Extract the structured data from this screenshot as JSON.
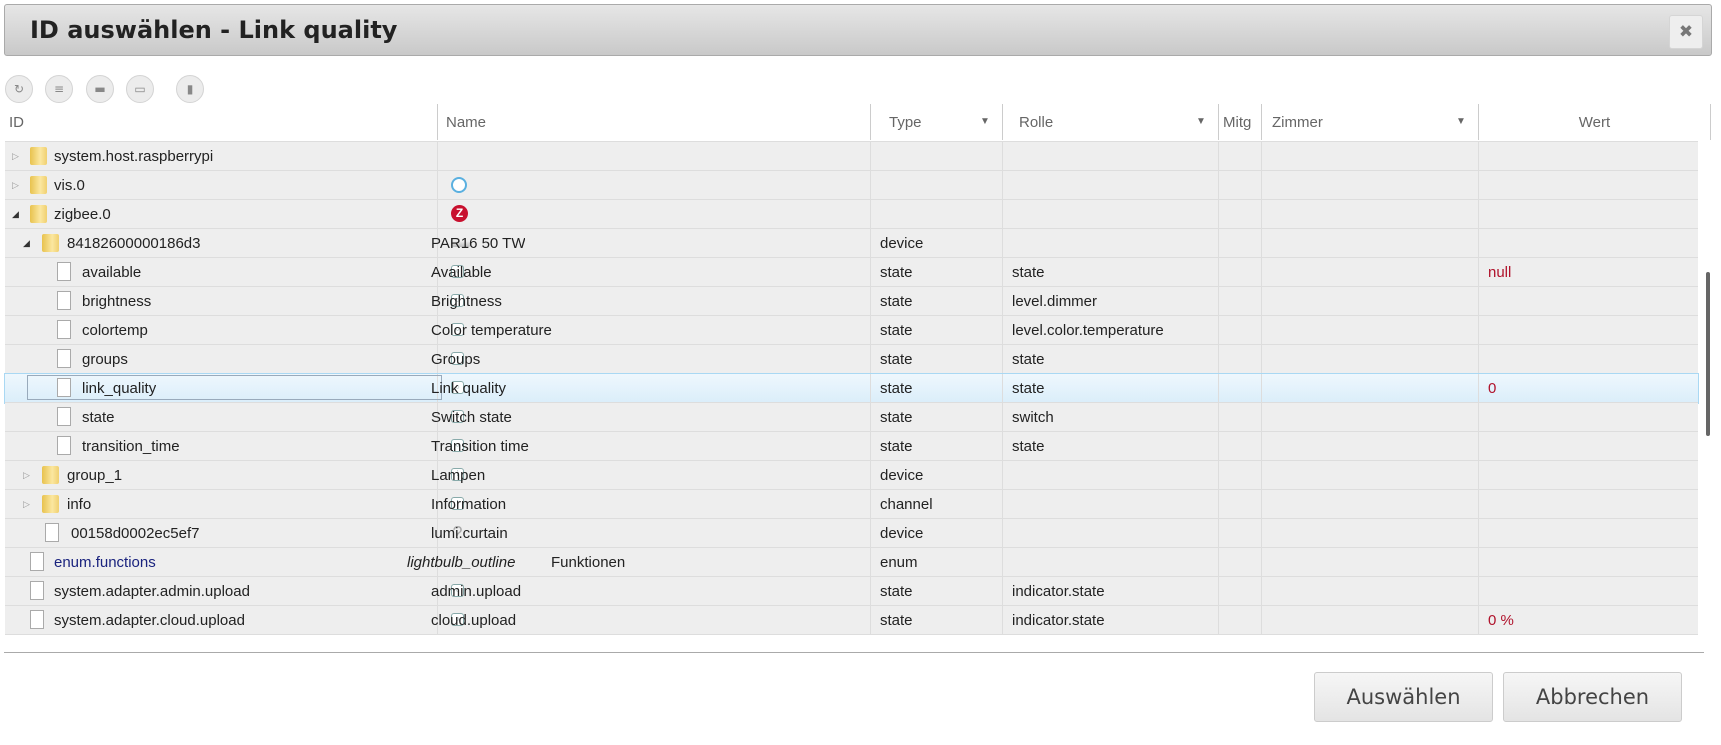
{
  "dialog": {
    "title": "ID auswählen - Link quality",
    "close_icon": "close-icon"
  },
  "toolbar": [
    {
      "icon": "refresh-icon",
      "glyph": "↻"
    },
    {
      "icon": "list-icon",
      "glyph": "≡"
    },
    {
      "icon": "folder-closed-icon",
      "glyph": "▬"
    },
    {
      "icon": "folder-open-icon",
      "glyph": "▭"
    },
    {
      "icon": "columns-icon",
      "glyph": "▮"
    }
  ],
  "columns": {
    "id": "ID",
    "name": "Name",
    "type": "Type",
    "role": "Rolle",
    "members": "Mitg",
    "room": "Zimmer",
    "value": "Wert"
  },
  "rows": [
    {
      "id": "system.host.raspberrypi",
      "level": 0,
      "kind": "folder",
      "expander": "collapsed",
      "name": "",
      "name_icon": "",
      "type": "",
      "role": "",
      "value": ""
    },
    {
      "id": "vis.0",
      "level": 0,
      "kind": "folder",
      "expander": "collapsed",
      "name": "",
      "name_icon": "vis",
      "type": "",
      "role": "",
      "value": ""
    },
    {
      "id": "zigbee.0",
      "level": 0,
      "kind": "folder",
      "expander": "expanded",
      "name": "",
      "name_icon": "zigbee",
      "type": "",
      "role": "",
      "value": ""
    },
    {
      "id": "84182600000186d3",
      "level": 1,
      "kind": "folder",
      "expander": "expanded",
      "name": "PAR16 50 TW",
      "name_icon": "lamp",
      "type": "device",
      "role": "",
      "value": ""
    },
    {
      "id": "available",
      "level": 2,
      "kind": "file",
      "expander": "none",
      "name": "Available",
      "name_icon": "state",
      "type": "state",
      "role": "state",
      "value": "null"
    },
    {
      "id": "brightness",
      "level": 2,
      "kind": "file",
      "expander": "none",
      "name": "Brightness",
      "name_icon": "state",
      "type": "state",
      "role": "level.dimmer",
      "value": ""
    },
    {
      "id": "colortemp",
      "level": 2,
      "kind": "file",
      "expander": "none",
      "name": "Color temperature",
      "name_icon": "state",
      "type": "state",
      "role": "level.color.temperature",
      "value": ""
    },
    {
      "id": "groups",
      "level": 2,
      "kind": "file",
      "expander": "none",
      "name": "Groups",
      "name_icon": "state",
      "type": "state",
      "role": "state",
      "value": ""
    },
    {
      "id": "link_quality",
      "level": 2,
      "kind": "file",
      "expander": "none",
      "name": "Link quality",
      "name_icon": "state",
      "type": "state",
      "role": "state",
      "value": "0",
      "selected": true
    },
    {
      "id": "state",
      "level": 2,
      "kind": "file",
      "expander": "none",
      "name": "Switch state",
      "name_icon": "state",
      "type": "state",
      "role": "switch",
      "value": ""
    },
    {
      "id": "transition_time",
      "level": 2,
      "kind": "file",
      "expander": "none",
      "name": "Transition time",
      "name_icon": "state",
      "type": "state",
      "role": "state",
      "value": ""
    },
    {
      "id": "group_1",
      "level": 1,
      "kind": "folder",
      "expander": "collapsed",
      "name": "Lampen",
      "name_icon": "group",
      "type": "device",
      "role": "",
      "value": ""
    },
    {
      "id": "info",
      "level": 1,
      "kind": "folder",
      "expander": "collapsed",
      "name": "Information",
      "name_icon": "info",
      "type": "channel",
      "role": "",
      "value": ""
    },
    {
      "id": "00158d0002ec5ef7",
      "level": 1,
      "kind": "file",
      "expander": "none",
      "name": "lumi.curtain",
      "name_icon": "question",
      "type": "device",
      "role": "",
      "value": ""
    },
    {
      "id": "enum.functions",
      "level": 0,
      "kind": "file",
      "expander": "none",
      "name_prefix": "lightbulb_outline",
      "name": "Funktionen",
      "name_icon": "",
      "type": "enum",
      "role": "",
      "value": "",
      "id_color": "#1a237e"
    },
    {
      "id": "system.adapter.admin.upload",
      "level": 0,
      "kind": "file",
      "expander": "none",
      "name": "admin.upload",
      "name_icon": "state",
      "type": "state",
      "role": "indicator.state",
      "value": ""
    },
    {
      "id": "system.adapter.cloud.upload",
      "level": 0,
      "kind": "file",
      "expander": "none",
      "name": "cloud.upload",
      "name_icon": "state",
      "type": "state",
      "role": "indicator.state",
      "value": "0 %"
    }
  ],
  "footer": {
    "select_label": "Auswählen",
    "cancel_label": "Abbrechen"
  },
  "colors": {
    "value": "#b0122b",
    "selection": "#a9d8f3"
  }
}
